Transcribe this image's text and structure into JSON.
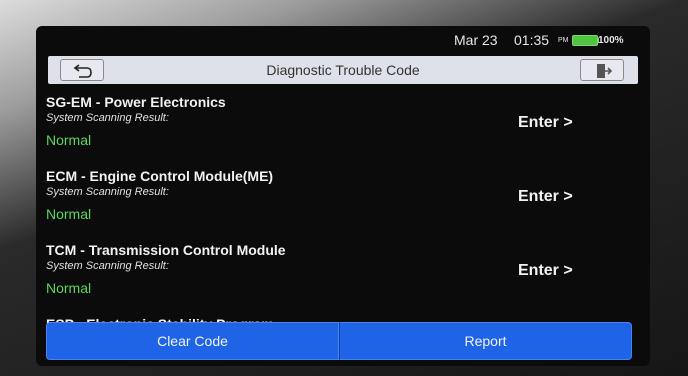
{
  "status": {
    "date": "Mar 23",
    "time": "01:35",
    "ampm": "PM",
    "battery": "100%",
    "battery_color": "#4fc43f"
  },
  "header": {
    "title": "Diagnostic Trouble Code",
    "back_icon": "back-arrow-icon",
    "exit_icon": "exit-door-icon"
  },
  "modules": [
    {
      "name": "SG-EM - Power Electronics",
      "subtitle": "System Scanning Result:",
      "result": "Normal",
      "action": "Enter >"
    },
    {
      "name": "ECM - Engine Control Module(ME)",
      "subtitle": "System Scanning Result:",
      "result": "Normal",
      "action": "Enter >"
    },
    {
      "name": "TCM - Transmission Control Module",
      "subtitle": "System Scanning Result:",
      "result": "Normal",
      "action": "Enter >"
    },
    {
      "name": "ESP - Electronic Stability Program",
      "subtitle": "",
      "result": "",
      "action": ""
    }
  ],
  "footer": {
    "clear_label": "Clear Code",
    "report_label": "Report",
    "button_color": "#1f63e6"
  },
  "colors": {
    "normal": "#5cd65c",
    "title_bar": "#dfe1ea"
  }
}
